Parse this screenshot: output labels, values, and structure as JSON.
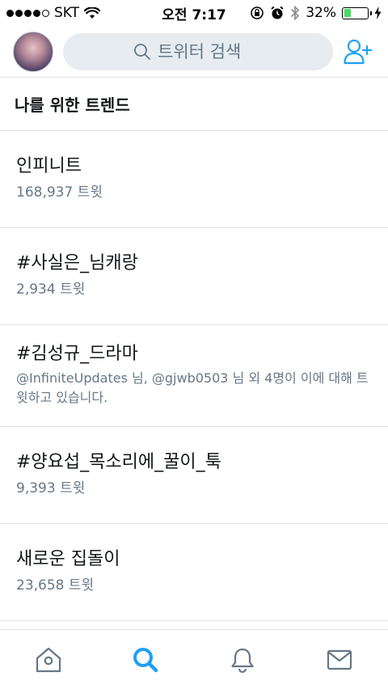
{
  "status_bar": {
    "carrier": "SKT",
    "time": "오전 7:17",
    "battery_percent": "32%",
    "battery_level": 0.32
  },
  "header": {
    "search_placeholder": "트위터 검색"
  },
  "section": {
    "title": "나를 위한 트렌드"
  },
  "trends": [
    {
      "title": "인피니트",
      "meta": "168,937 트윗"
    },
    {
      "title": "#사실은_님캐랑",
      "meta": "2,934 트윗"
    },
    {
      "title": "#김성규_드라마",
      "meta": "@InfiniteUpdates 님, @gjwb0503 님 외 4명이 이에 대해 트윗하고 있습니다."
    },
    {
      "title": "#양요섭_목소리에_꿀이_툭",
      "meta": "9,393 트윗"
    },
    {
      "title": "새로운 집돌이",
      "meta": "23,658 트윗"
    }
  ],
  "tabs": [
    {
      "icon": "home-icon",
      "active": false
    },
    {
      "icon": "search-icon",
      "active": true
    },
    {
      "icon": "bell-icon",
      "active": false
    },
    {
      "icon": "mail-icon",
      "active": false
    }
  ],
  "colors": {
    "accent": "#1da1f2",
    "muted": "#657786",
    "tab_icon": "#657786"
  }
}
